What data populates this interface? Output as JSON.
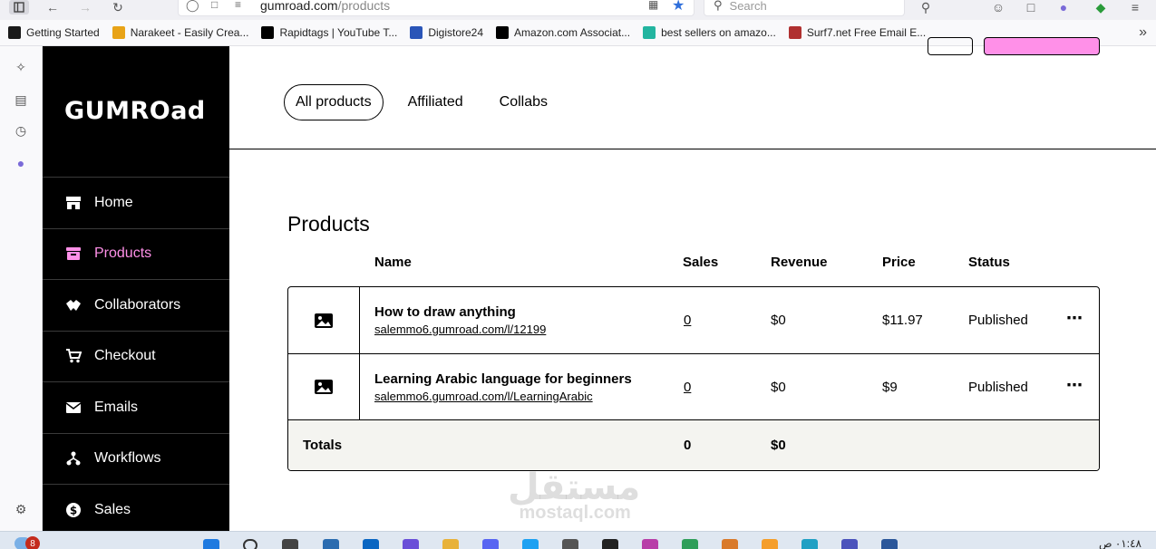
{
  "browser": {
    "url_host": "gumroad.com",
    "url_path": "/products",
    "search_placeholder": "Search",
    "bookmarks": [
      {
        "label": "Getting Started",
        "icon": "getting-started-icon",
        "color": "#1a1a1a"
      },
      {
        "label": "Narakeet - Easily Crea...",
        "icon": "narakeet-icon",
        "color": "#e8a317"
      },
      {
        "label": "Rapidtags | YouTube T...",
        "icon": "rapidtags-icon",
        "color": "#000000"
      },
      {
        "label": "Digistore24",
        "icon": "digistore-icon",
        "color": "#2a55b8"
      },
      {
        "label": "Amazon.com Associat...",
        "icon": "amazon-icon",
        "color": "#000000"
      },
      {
        "label": "best sellers on amazo...",
        "icon": "bestsellers-icon",
        "color": "#23b5a0"
      },
      {
        "label": "Surf7.net Free Email E...",
        "icon": "surf7-icon",
        "color": "#b03030"
      }
    ]
  },
  "app": {
    "logo": "GUMROad",
    "accent": "#ff90e8",
    "nav": [
      {
        "label": "Home",
        "icon": "home-icon"
      },
      {
        "label": "Products",
        "icon": "products-icon",
        "active": true
      },
      {
        "label": "Collaborators",
        "icon": "collaborators-icon"
      },
      {
        "label": "Checkout",
        "icon": "checkout-icon"
      },
      {
        "label": "Emails",
        "icon": "emails-icon"
      },
      {
        "label": "Workflows",
        "icon": "workflows-icon"
      },
      {
        "label": "Sales",
        "icon": "sales-icon"
      }
    ]
  },
  "main": {
    "tabs": [
      "All products",
      "Affiliated",
      "Collabs"
    ],
    "title": "Products",
    "columns": {
      "name": "Name",
      "sales": "Sales",
      "revenue": "Revenue",
      "price": "Price",
      "status": "Status"
    },
    "products": [
      {
        "name": "How to draw anything",
        "link": "salemmo6.gumroad.com/l/12199",
        "sales": "0",
        "revenue": "$0",
        "price": "$11.97",
        "status": "Published"
      },
      {
        "name": "Learning Arabic language for beginners",
        "link": "salemmo6.gumroad.com/l/LearningArabic",
        "sales": "0",
        "revenue": "$0",
        "price": "$9",
        "status": "Published"
      }
    ],
    "totals": {
      "label": "Totals",
      "sales": "0",
      "revenue": "$0"
    }
  },
  "watermark": {
    "arabic": "مستقل",
    "latin": "mostaql.com"
  },
  "taskbar": {
    "badge": "8",
    "clock": "٠١:٤٨ ص"
  }
}
